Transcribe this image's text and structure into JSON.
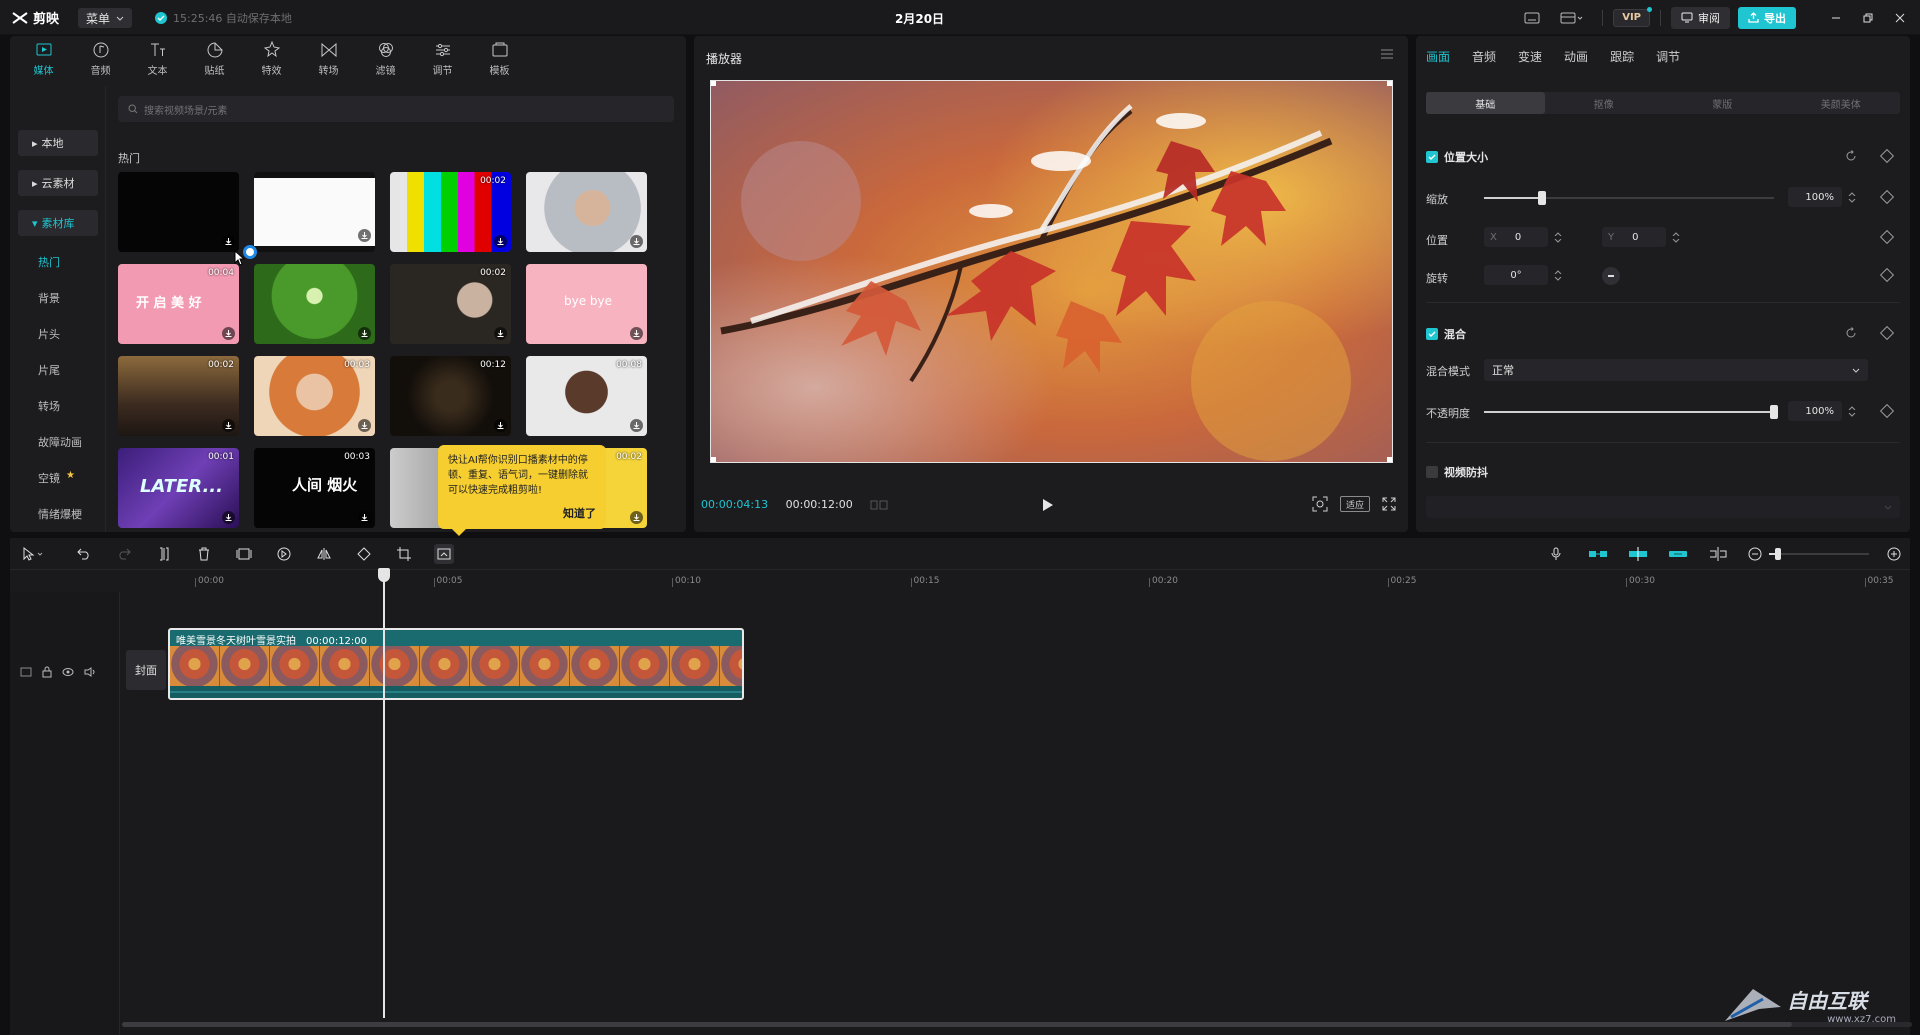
{
  "titlebar": {
    "app_name": "剪映",
    "menu_label": "菜单",
    "save_status": "15:25:46 自动保存本地",
    "project_title": "2月20日",
    "vip_label": "VIP",
    "review_label": "审阅",
    "export_label": "导出"
  },
  "media": {
    "tabs": [
      {
        "label": "媒体",
        "icon": "media-icon"
      },
      {
        "label": "音频",
        "icon": "audio-icon"
      },
      {
        "label": "文本",
        "icon": "text-icon"
      },
      {
        "label": "贴纸",
        "icon": "sticker-icon"
      },
      {
        "label": "特效",
        "icon": "effects-icon"
      },
      {
        "label": "转场",
        "icon": "transition-icon"
      },
      {
        "label": "滤镜",
        "icon": "filter-icon"
      },
      {
        "label": "调节",
        "icon": "adjust-icon"
      },
      {
        "label": "模板",
        "icon": "template-icon"
      }
    ],
    "sidebar": {
      "local": "本地",
      "cloud": "云素材",
      "library": "素材库",
      "sub": [
        "热门",
        "背景",
        "片头",
        "片尾",
        "转场",
        "故障动画",
        "空镜",
        "情绪爆梗",
        "氛围"
      ]
    },
    "search_placeholder": "搜索视频场景/元素",
    "section_label": "热门",
    "thumbs": [
      {
        "duration": ""
      },
      {
        "duration": ""
      },
      {
        "duration": "00:02"
      },
      {
        "duration": ""
      },
      {
        "duration": "00:04",
        "text": "开 启 美 好"
      },
      {
        "duration": ""
      },
      {
        "duration": "00:02"
      },
      {
        "duration": "",
        "text": "bye bye"
      },
      {
        "duration": "00:02"
      },
      {
        "duration": "00:03"
      },
      {
        "duration": "00:12"
      },
      {
        "duration": "00:08"
      },
      {
        "duration": "00:01",
        "text": "LATER..."
      },
      {
        "duration": "00:03",
        "text": "人间 烟火"
      },
      {
        "duration": ""
      },
      {
        "duration": "00:02"
      }
    ],
    "tooltip": {
      "text": "快让AI帮你识别口播素材中的停顿、重复、语气词，一键删除就可以快速完成粗剪啦!",
      "ok": "知道了"
    }
  },
  "player": {
    "title": "播放器",
    "current_time": "00:00:04:13",
    "total_time": "00:00:12:00",
    "ratio_label": "适应"
  },
  "props": {
    "tabs": [
      "画面",
      "音频",
      "变速",
      "动画",
      "跟踪",
      "调节"
    ],
    "subtabs": [
      "基础",
      "抠像",
      "蒙版",
      "美颜美体"
    ],
    "position_size": {
      "title": "位置大小",
      "scale_label": "缩放",
      "scale_value": "100%",
      "scale_fraction": 0.2,
      "position_label": "位置",
      "x_label": "X",
      "x_value": "0",
      "y_label": "Y",
      "y_value": "0",
      "rotate_label": "旋转",
      "rotate_value": "0°"
    },
    "blend": {
      "title": "混合",
      "mode_label": "混合模式",
      "mode_value": "正常",
      "opacity_label": "不透明度",
      "opacity_value": "100%",
      "opacity_fraction": 1.0
    },
    "stabilize": {
      "title": "视频防抖"
    }
  },
  "timeline": {
    "ticks": [
      "00:00",
      "00:05",
      "00:10",
      "00:15",
      "00:20",
      "00:25",
      "00:30",
      "00:35"
    ],
    "cover_label": "封面",
    "clip": {
      "title": "唯美雪景冬天树叶雪景实拍",
      "duration": "00:00:12:00"
    }
  },
  "watermark": {
    "text": "自由互联",
    "url": "www.xz7.com"
  },
  "colors": {
    "accent": "#1fc5d0",
    "panel": "#1c1c1f",
    "background": "#0f0f11",
    "tooltip": "#f6ce2f"
  }
}
